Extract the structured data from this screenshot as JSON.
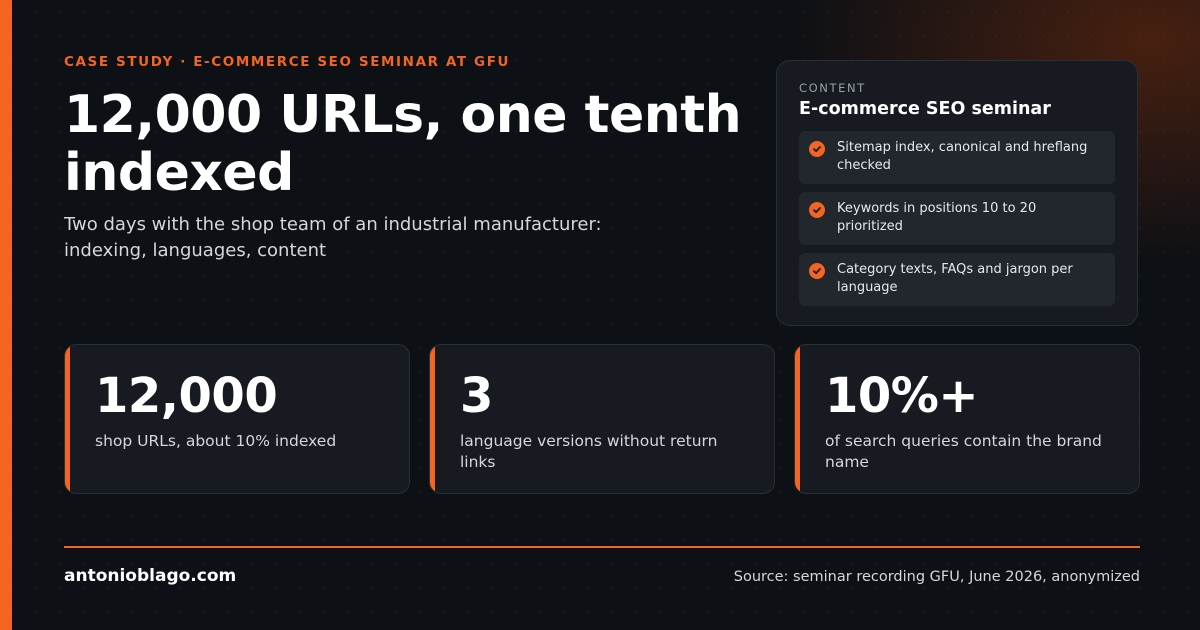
{
  "header": {
    "kicker": "CASE STUDY · E-COMMERCE SEO SEMINAR AT GFU",
    "title": "12,000 URLs, one tenth indexed",
    "subtitle": "Two days with the shop team of an industrial manufacturer: indexing, languages, content"
  },
  "content_card": {
    "label": "CONTENT",
    "title": "E-commerce SEO seminar",
    "items": [
      {
        "text": "Sitemap index, canonical and hreflang checked",
        "icon": "check-circle-icon"
      },
      {
        "text": "Keywords in positions 10 to 20 prioritized",
        "icon": "check-circle-icon"
      },
      {
        "text": "Category texts, FAQs and jargon per language",
        "icon": "check-circle-icon"
      }
    ]
  },
  "stats": [
    {
      "value": "12,000",
      "desc": "shop URLs, about 10% indexed"
    },
    {
      "value": "3",
      "desc": "language versions without return links"
    },
    {
      "value": "10%+",
      "desc": "of search queries contain the brand name"
    }
  ],
  "footer": {
    "site": "antonioblago.com",
    "source": "Source: seminar recording GFU, June 2026, anonymized"
  },
  "colors": {
    "accent": "#f26522",
    "background": "#0d1015",
    "card": "#171a20"
  }
}
